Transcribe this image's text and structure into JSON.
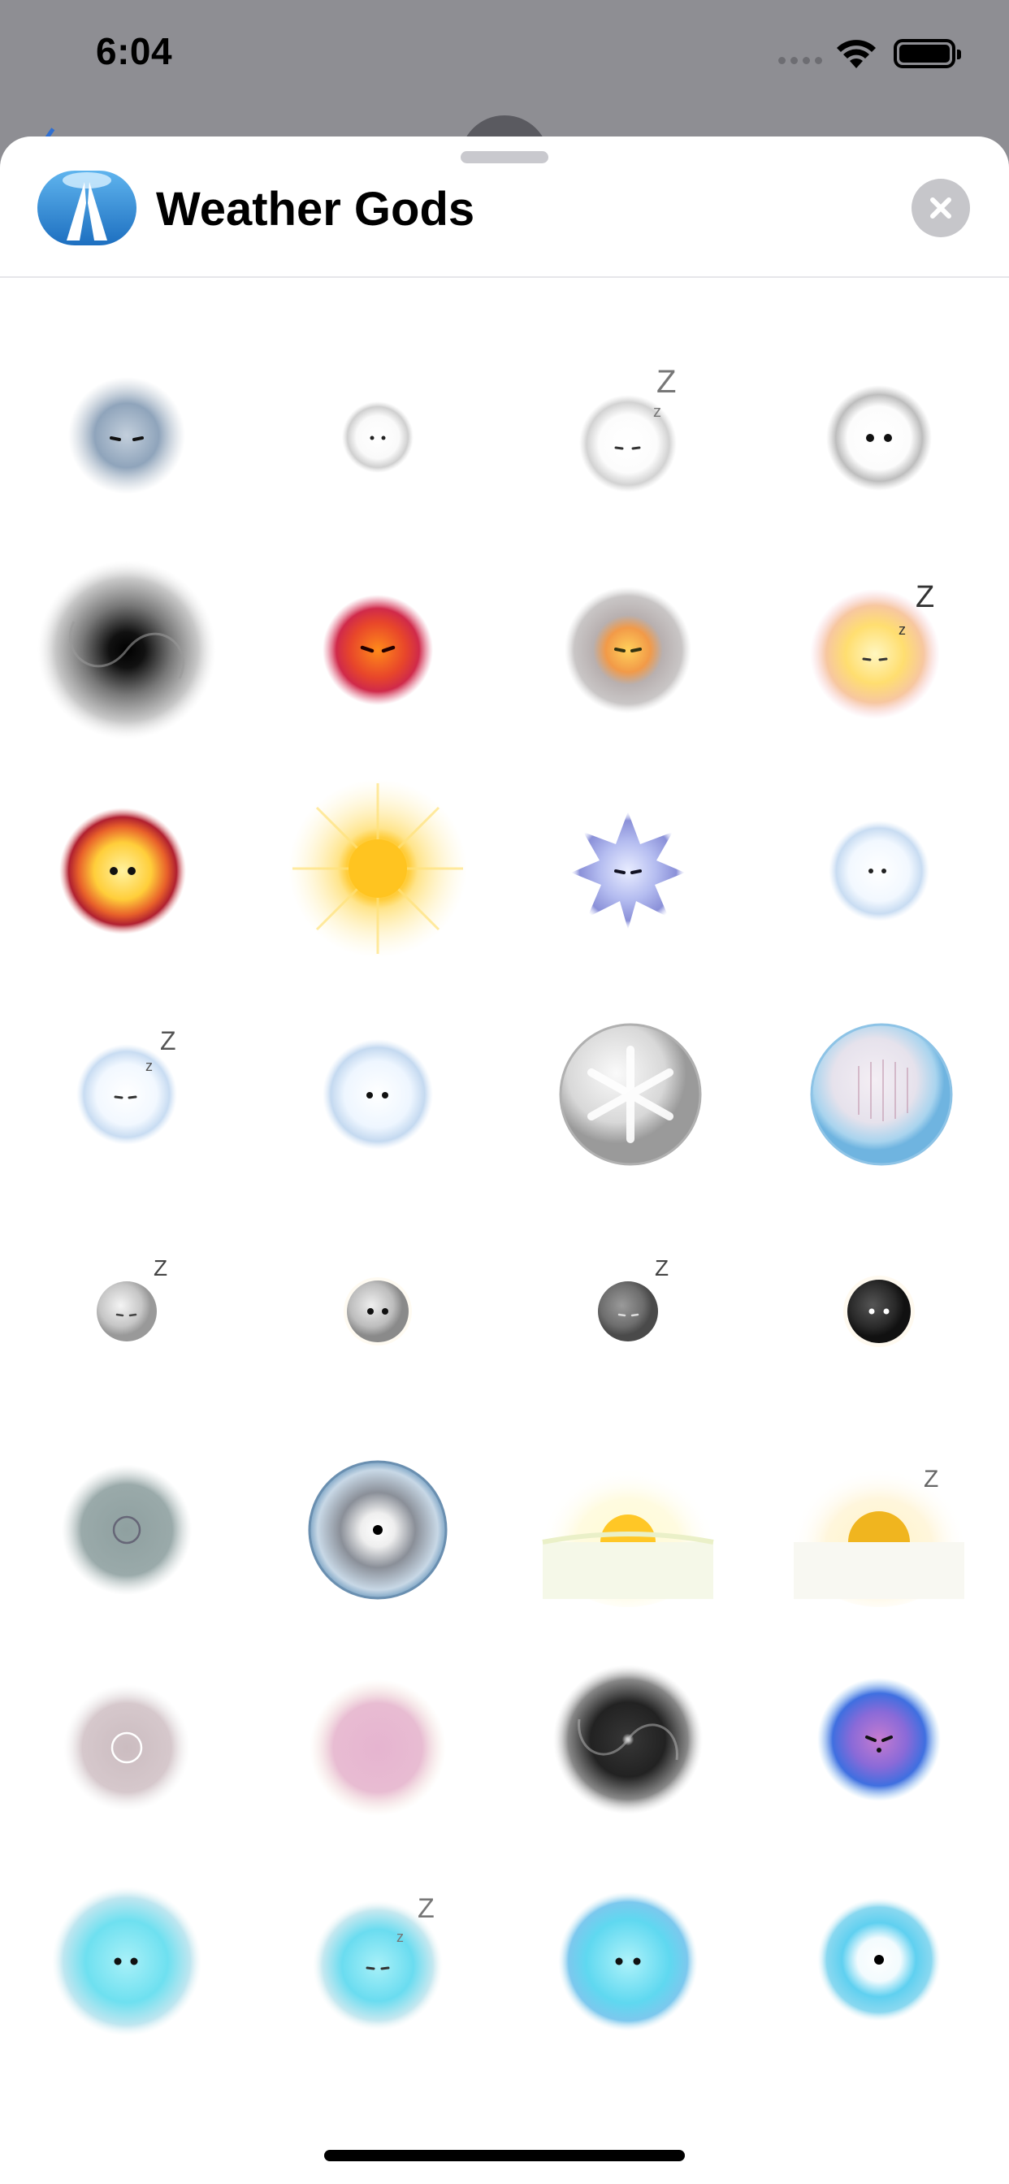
{
  "status_bar": {
    "time": "6:04",
    "icons": [
      "cellular-icon",
      "wifi-icon",
      "battery-icon"
    ]
  },
  "sheet": {
    "app_name": "Weather Gods",
    "app_icon": "weather-gods-app-icon",
    "close_icon": "close-icon",
    "accent_color": "#2e86d8"
  },
  "stickers": [
    {
      "name": "gray-cloud-frowning"
    },
    {
      "name": "small-white-cloud"
    },
    {
      "name": "white-cloud-sleeping",
      "text": "Z"
    },
    {
      "name": "white-cloud"
    },
    {
      "name": "dark-vortex"
    },
    {
      "name": "red-fireball-angry"
    },
    {
      "name": "smoky-orange-sun"
    },
    {
      "name": "yellow-sun-sleeping",
      "text": "Z"
    },
    {
      "name": "fiery-sun"
    },
    {
      "name": "radiant-sun"
    },
    {
      "name": "purple-snowflake"
    },
    {
      "name": "fluffy-snow-cloud"
    },
    {
      "name": "snow-cloud-sleeping",
      "text": "Z"
    },
    {
      "name": "snow-cloud"
    },
    {
      "name": "snowflake-globe"
    },
    {
      "name": "frosty-glass-globe"
    },
    {
      "name": "full-moon-sleeping",
      "text": "Z"
    },
    {
      "name": "full-moon"
    },
    {
      "name": "gray-moon-sleeping",
      "text": "Z"
    },
    {
      "name": "dark-moon"
    },
    {
      "name": "gray-mist-ring"
    },
    {
      "name": "glass-eye-orb"
    },
    {
      "name": "sunrise"
    },
    {
      "name": "sunrise-sleeping",
      "text": "Z"
    },
    {
      "name": "faint-gray-mist"
    },
    {
      "name": "pink-mist"
    },
    {
      "name": "dark-hurricane"
    },
    {
      "name": "purple-storm-cloud"
    },
    {
      "name": "cyan-splash"
    },
    {
      "name": "cyan-splash-sleeping",
      "text": "Z"
    },
    {
      "name": "cyan-bubble-cloud"
    },
    {
      "name": "cyan-eye-swirl"
    }
  ]
}
